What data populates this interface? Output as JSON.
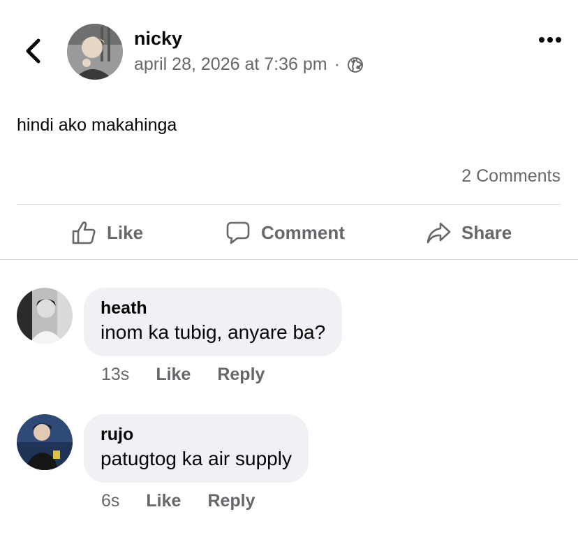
{
  "header": {
    "author_name": "nicky",
    "timestamp": "april 28, 2026 at 7:36 pm",
    "separator": "·",
    "icons": {
      "back": "chevron-left-icon",
      "privacy": "globe-icon",
      "more": "more-horizontal-icon"
    }
  },
  "post": {
    "text": "hindi ako makahinga",
    "comment_count_label": "2 Comments"
  },
  "actions": {
    "like_label": "Like",
    "comment_label": "Comment",
    "share_label": "Share"
  },
  "comments": [
    {
      "author": "heath",
      "text": "inom ka tubig, anyare ba?",
      "time": "13s",
      "like_label": "Like",
      "reply_label": "Reply"
    },
    {
      "author": "rujo",
      "text": "patugtog ka air supply",
      "time": "6s",
      "like_label": "Like",
      "reply_label": "Reply"
    }
  ],
  "colors": {
    "text_primary": "#050505",
    "text_secondary": "#65676b",
    "bubble_bg": "#f0f0f5",
    "divider": "#dadde1"
  }
}
